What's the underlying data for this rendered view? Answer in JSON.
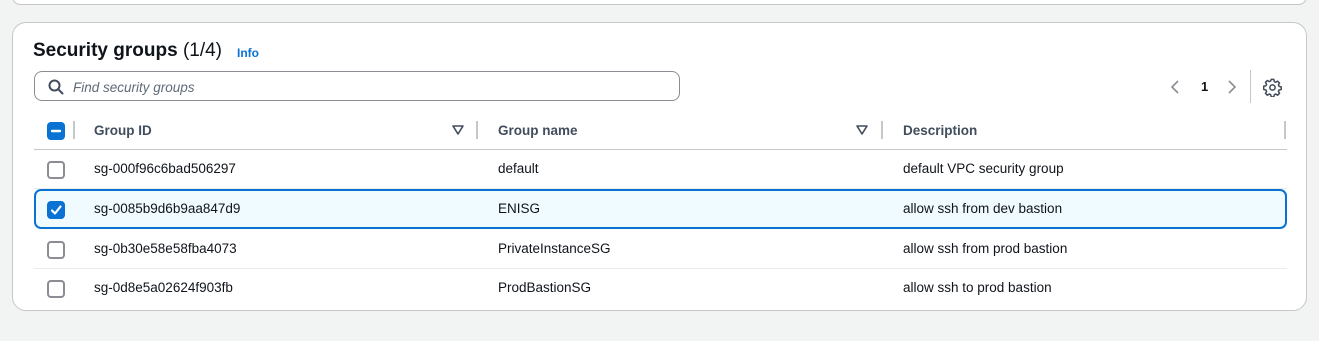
{
  "section": {
    "title": "Security groups",
    "count": "(1/4)",
    "info_link": "Info"
  },
  "search": {
    "placeholder": "Find security groups",
    "value": ""
  },
  "pagination": {
    "current_page": "1"
  },
  "table": {
    "columns": [
      "Group ID",
      "Group name",
      "Description"
    ],
    "rows": [
      {
        "group_id": "sg-000f96c6bad506297",
        "group_name": "default",
        "description": "default VPC security group",
        "selected": false
      },
      {
        "group_id": "sg-0085b9d6b9aa847d9",
        "group_name": "ENISG",
        "description": "allow ssh from dev bastion",
        "selected": true
      },
      {
        "group_id": "sg-0b30e58e58fba4073",
        "group_name": "PrivateInstanceSG",
        "description": "allow ssh from prod bastion",
        "selected": false
      },
      {
        "group_id": "sg-0d8e5a02624f903fb",
        "group_name": "ProdBastionSG",
        "description": "allow ssh to prod bastion",
        "selected": false
      }
    ]
  },
  "icons": {
    "search": "search-icon",
    "prev": "chevron-left-icon",
    "next": "chevron-right-icon",
    "settings": "gear-icon",
    "sort": "caret-down-icon"
  },
  "colors": {
    "accent": "#0972d3",
    "selected_row_bg": "#f0fbff"
  }
}
